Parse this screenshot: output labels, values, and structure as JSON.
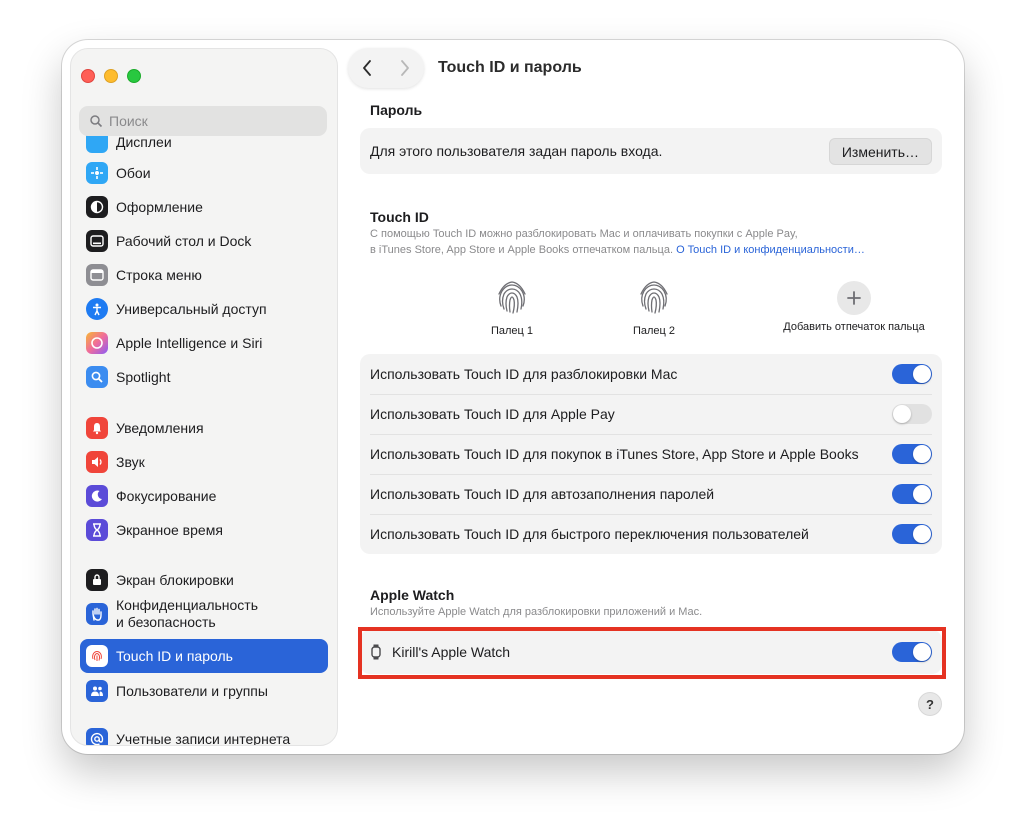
{
  "window": {
    "title": "Touch ID и пароль"
  },
  "sidebar": {
    "search_placeholder": "Поиск",
    "partial_top_item": "Дисплеи",
    "items": [
      {
        "label": "Обои",
        "icon": "wallpaper-icon",
        "color": "#2fa7f5"
      },
      {
        "label": "Оформление",
        "icon": "appearance-icon",
        "color": "#1d1d1f"
      },
      {
        "label": "Рабочий стол и Dock",
        "icon": "desktop-dock-icon",
        "color": "#1d1d1f"
      },
      {
        "label": "Строка меню",
        "icon": "menubar-icon",
        "color": "#8e8e93"
      },
      {
        "label": "Универсальный доступ",
        "icon": "accessibility-icon",
        "color": "#1e7bf2"
      },
      {
        "label": "Apple Intelligence и Siri",
        "icon": "siri-icon",
        "color": "#f06c9b"
      },
      {
        "label": "Spotlight",
        "icon": "spotlight-icon",
        "color": "#3b8cf0"
      },
      {
        "label": "Уведомления",
        "icon": "notifications-icon",
        "color": "#f0453a"
      },
      {
        "label": "Звук",
        "icon": "sound-icon",
        "color": "#f0453a"
      },
      {
        "label": "Фокусирование",
        "icon": "focus-icon",
        "color": "#5b4bd8"
      },
      {
        "label": "Экранное время",
        "icon": "screentime-icon",
        "color": "#5b4bd8"
      },
      {
        "label": "Экран блокировки",
        "icon": "lockscreen-icon",
        "color": "#1d1d1f"
      },
      {
        "label": "Конфиденциальность\nи безопасность",
        "icon": "privacy-hand-icon",
        "color": "#2a64d8"
      },
      {
        "label": "Touch ID и пароль",
        "icon": "fingerprint-icon",
        "color": "#ffffff"
      },
      {
        "label": "Пользователи и группы",
        "icon": "users-icon",
        "color": "#2a64d8"
      },
      {
        "label": "Учетные записи интернета",
        "icon": "at-icon",
        "color": "#2a64d8"
      }
    ],
    "active_index": 13
  },
  "main": {
    "password": {
      "title": "Пароль",
      "row_text": "Для этого пользователя задан пароль входа.",
      "change_button": "Изменить…"
    },
    "touchid": {
      "title": "Touch ID",
      "desc_line1": "С помощью Touch ID можно разблокировать Mac и оплачивать покупки с Apple Pay,",
      "desc_line2": "в iTunes Store, App Store и Apple Books отпечатком пальца.",
      "desc_link": "О Touch ID и конфиденциальности…",
      "fingers": [
        {
          "label": "Палец 1"
        },
        {
          "label": "Палец 2"
        }
      ],
      "add_label": "Добавить отпечаток пальца",
      "options": [
        {
          "label": "Использовать Touch ID для разблокировки Mac",
          "on": true
        },
        {
          "label": "Использовать Touch ID для Apple Pay",
          "on": false
        },
        {
          "label": "Использовать Touch ID для покупок в iTunes Store, App Store и Apple Books",
          "on": true
        },
        {
          "label": "Использовать Touch ID для автозаполнения паролей",
          "on": true
        },
        {
          "label": "Использовать Touch ID для быстрого переключения пользователей",
          "on": true
        }
      ]
    },
    "apple_watch": {
      "title": "Apple Watch",
      "desc": "Используйте Apple Watch для разблокировки приложений и Mac.",
      "device_name": "Kirill's Apple Watch",
      "on": true
    },
    "help_label": "?"
  },
  "colors": {
    "accent": "#2a64d8",
    "highlight": "#e53222"
  }
}
